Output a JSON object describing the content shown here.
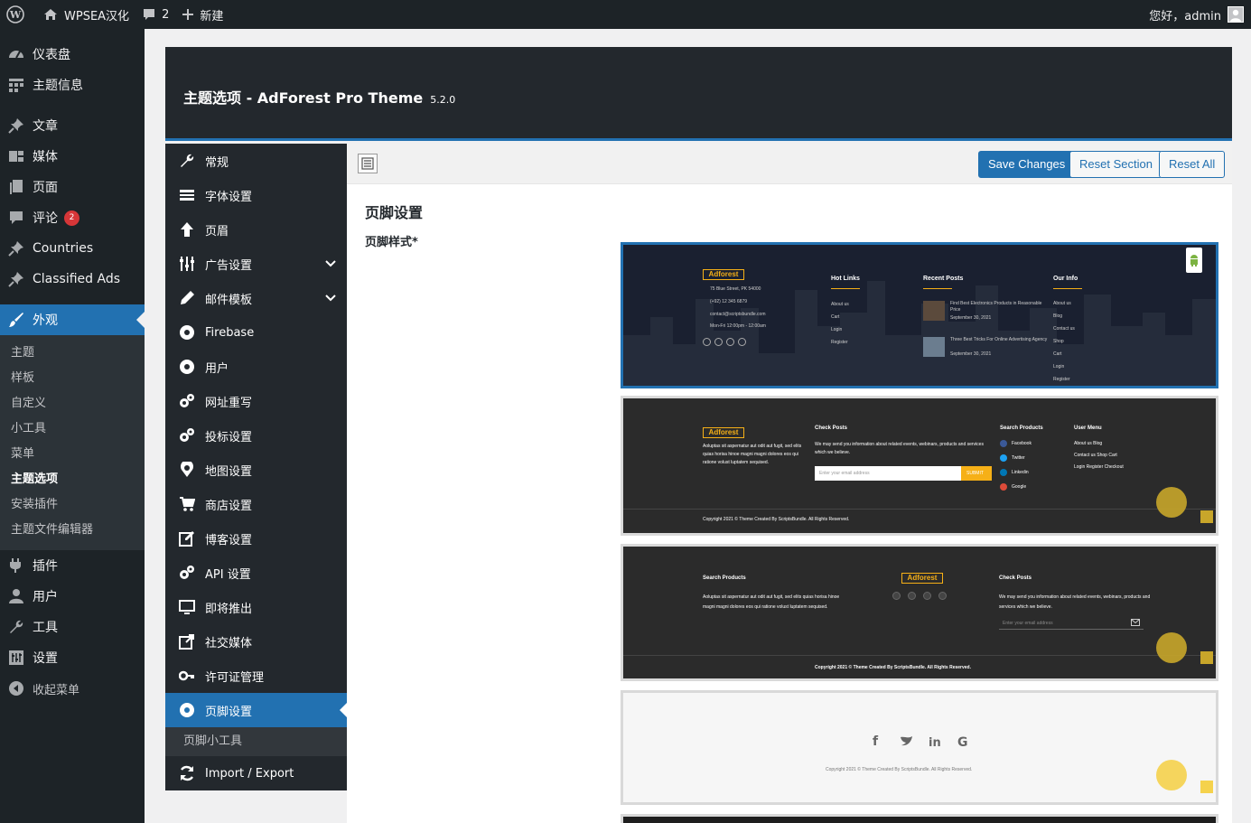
{
  "admin_bar": {
    "site_name": "WPSEA汉化",
    "comments_count": "2",
    "new_label": "新建",
    "greeting": "您好，admin"
  },
  "wp_menu": {
    "dashboard": "仪表盘",
    "theme_info": "主题信息",
    "posts": "文章",
    "media": "媒体",
    "pages": "页面",
    "comments": "评论",
    "comments_badge": "2",
    "countries": "Countries",
    "classified_ads": "Classified Ads",
    "appearance": "外观",
    "appearance_sub": [
      "主题",
      "样板",
      "自定义",
      "小工具",
      "菜单",
      "主题选项",
      "安装插件",
      "主题文件编辑器"
    ],
    "plugins": "插件",
    "users": "用户",
    "tools": "工具",
    "settings": "设置",
    "collapse": "收起菜单"
  },
  "panel": {
    "title": "主题选项 - AdForest Pro Theme",
    "version": "5.2.0"
  },
  "option_menu": {
    "items": [
      "常规",
      "字体设置",
      "页眉",
      "广告设置",
      "邮件模板",
      "Firebase",
      "用户",
      "网址重写",
      "投标设置",
      "地图设置",
      "商店设置",
      "博客设置",
      "API 设置",
      "即将推出",
      "社交媒体",
      "许可证管理",
      "页脚设置"
    ],
    "sub_item": "页脚小工具",
    "import_export": "Import / Export"
  },
  "toolbar": {
    "save": "Save Changes",
    "reset_section": "Reset Section",
    "reset_all": "Reset All"
  },
  "section": {
    "title": "页脚设置",
    "field_label": "页脚样式*"
  },
  "previews": {
    "p1": {
      "logo": "Adforest",
      "address": "75 Blue Street, PK 54000",
      "phone": "(+92) 12 345 6879",
      "email": "contact@scriptsbundle.com",
      "hours": "Mon-Fri 12:00pm - 12:00am",
      "hot_links": "Hot Links",
      "hot_links_items": [
        "About us",
        "Cart",
        "Login",
        "Register"
      ],
      "recent_posts": "Recent Posts",
      "post1_title": "Find Best Electronics Products in Reasonable Price",
      "post1_date": "September 30, 2021",
      "post2_title": "Three Best Tricks For Online Advertising Agency",
      "post2_date": "September 30, 2021",
      "our_info": "Our Info",
      "our_info_items": [
        "About us",
        "Blog",
        "Contact us",
        "Shop",
        "Cart",
        "Login",
        "Register"
      ]
    },
    "p2": {
      "logo": "Adforest",
      "about_text": "Aoluptas sit aspernatur aut odit aut fugit, sed elits quias horisa hinoe magni magni dolores eos qui ratione volust luptatem sequised.",
      "check_posts": "Check Posts",
      "check_text": "We may send you information about related events, webinars, products and services which we believe.",
      "email_placeholder": "Enter your email address",
      "submit": "SUBMIT",
      "search_products": "Search Products",
      "social": [
        "Facebook",
        "Twitter",
        "Linkedin",
        "Google"
      ],
      "user_menu": "User Menu",
      "user_menu_lines": [
        "About us Blog",
        "Contact us Shop Cart",
        "Login Register Checkout"
      ],
      "copyright": "Copyright 2021 © Theme Created By ScriptsBundle. All Rights Reserved."
    },
    "p3": {
      "search_products": "Search Products",
      "about_text": "Aoluptas sit aspernatur aut odit aut fugit, sed elits quias horisa hinoe magni magni dolores eos qui ratione volust luptatem sequised.",
      "logo": "Adforest",
      "check_posts": "Check Posts",
      "check_text": "We may send you information about related events, webinars, products and services which we believe.",
      "email_placeholder": "Enter your email address",
      "copyright": "Copyright 2021 © Theme Created By ScriptsBundle. All Rights Reserved."
    },
    "p4": {
      "copyright": "Copyright 2021 © Theme Created By ScriptsBundle. All Rights Reserved."
    }
  },
  "colors": {
    "accent": "#2271b1",
    "adminbar": "#1d2327",
    "panel_dark": "#23282d",
    "gold": "#f6b017"
  }
}
